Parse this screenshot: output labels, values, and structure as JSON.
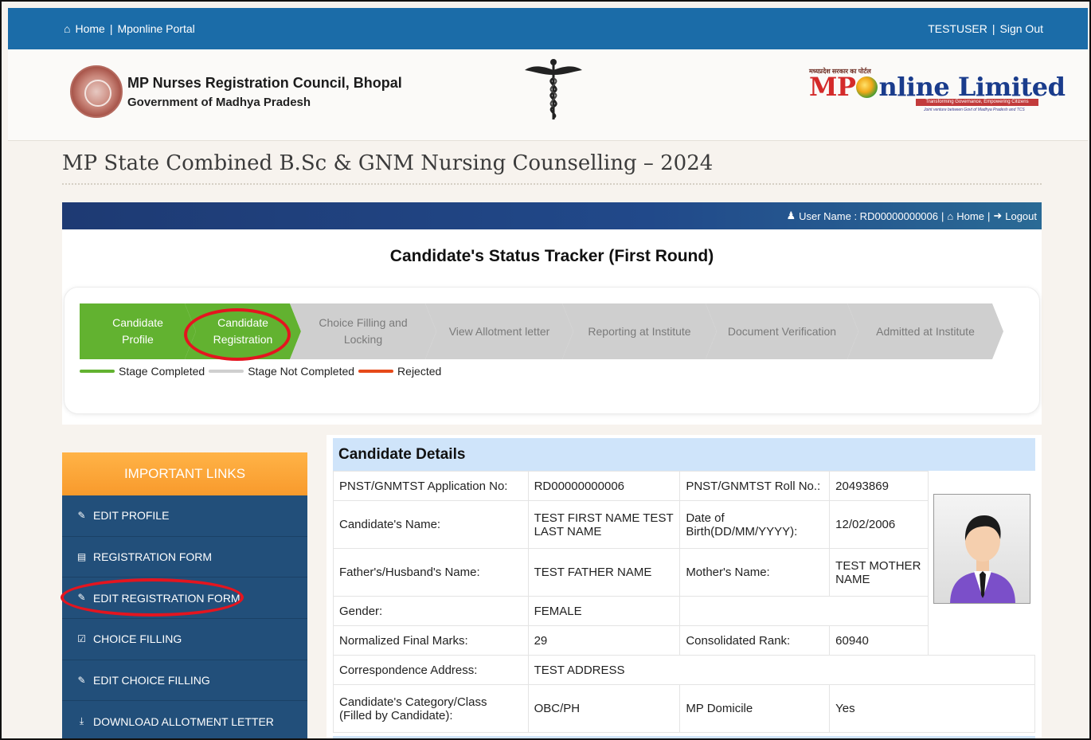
{
  "topbar": {
    "home": "Home",
    "sep": "|",
    "portal": "Mponline Portal",
    "user": "TESTUSER",
    "signout": "Sign Out"
  },
  "header": {
    "org_name": "MP Nurses Registration Council, Bhopal",
    "org_sub": "Government of Madhya Pradesh",
    "mp_tag": "मध्यप्रदेश सरकार का पोर्टल",
    "mp_logo_a": "MP",
    "mp_logo_b": "nline Limited",
    "mp_tagline": "Transforming Governance, Empowering Citizens",
    "mp_tagline2": "Joint venture between Govt of Madhya Pradesh and TCS"
  },
  "page_title": "MP State Combined B.Sc & GNM Nursing Counselling – 2024",
  "userbar": {
    "user_label": "User Name : RD00000000006",
    "home": "Home",
    "logout": "Logout",
    "sep": "|"
  },
  "tracker": {
    "title": "Candidate's Status Tracker (First Round)",
    "steps": [
      {
        "line1": "Candidate",
        "line2": "Profile",
        "status": "done"
      },
      {
        "line1": "Candidate",
        "line2": "Registration",
        "status": "done"
      },
      {
        "line1": "Choice Filling and",
        "line2": "Locking",
        "status": "pending"
      },
      {
        "line1": "View Allotment letter",
        "line2": "",
        "status": "pending"
      },
      {
        "line1": "Reporting at Institute",
        "line2": "",
        "status": "pending"
      },
      {
        "line1": "Document Verification",
        "line2": "",
        "status": "pending"
      },
      {
        "line1": "Admitted at Institute",
        "line2": "",
        "status": "pending"
      }
    ],
    "legend": {
      "completed": "Stage Completed",
      "not_completed": "Stage Not Completed",
      "rejected": "Rejected"
    }
  },
  "sidebar": {
    "heading": "IMPORTANT LINKS",
    "items": [
      {
        "label": "EDIT PROFILE",
        "icon": "edit-icon"
      },
      {
        "label": "REGISTRATION FORM",
        "icon": "id-card-icon"
      },
      {
        "label": "EDIT REGISTRATION FORM",
        "icon": "edit-icon"
      },
      {
        "label": "CHOICE FILLING",
        "icon": "checkbox-icon"
      },
      {
        "label": "EDIT CHOICE FILLING",
        "icon": "edit-icon"
      },
      {
        "label": "DOWNLOAD ALLOTMENT LETTER",
        "icon": "download-icon"
      }
    ]
  },
  "details": {
    "heading": "Candidate Details",
    "app_no_label": "PNST/GNMTST Application No:",
    "app_no": "RD00000000006",
    "roll_label": "PNST/GNMTST Roll No.:",
    "roll": "20493869",
    "name_label": "Candidate's Name:",
    "name": "TEST FIRST NAME TEST LAST NAME",
    "dob_label": "Date of Birth(DD/MM/YYYY):",
    "dob": "12/02/2006",
    "father_label": "Father's/Husband's Name:",
    "father": "TEST FATHER NAME",
    "mother_label": "Mother's Name:",
    "mother": "TEST MOTHER NAME",
    "gender_label": "Gender:",
    "gender": "FEMALE",
    "marks_label": "Normalized Final Marks:",
    "marks": "29",
    "rank_label": "Consolidated Rank:",
    "rank": "60940",
    "address_label": "Correspondence Address:",
    "address": "TEST ADDRESS",
    "category_label": "Candidate's Category/Class (Filled by Candidate):",
    "category": "OBC/PH",
    "domicile_label": "MP Domicile",
    "domicile": "Yes"
  },
  "colors": {
    "topbar": "#1b6ca8",
    "stage_completed": "#62b230",
    "stage_not_completed": "#cfcfcf",
    "rejected": "#e64a19",
    "sidebar": "#224f7a",
    "sidebar_head": "#f89a2c",
    "highlight_red": "#e4151f"
  }
}
